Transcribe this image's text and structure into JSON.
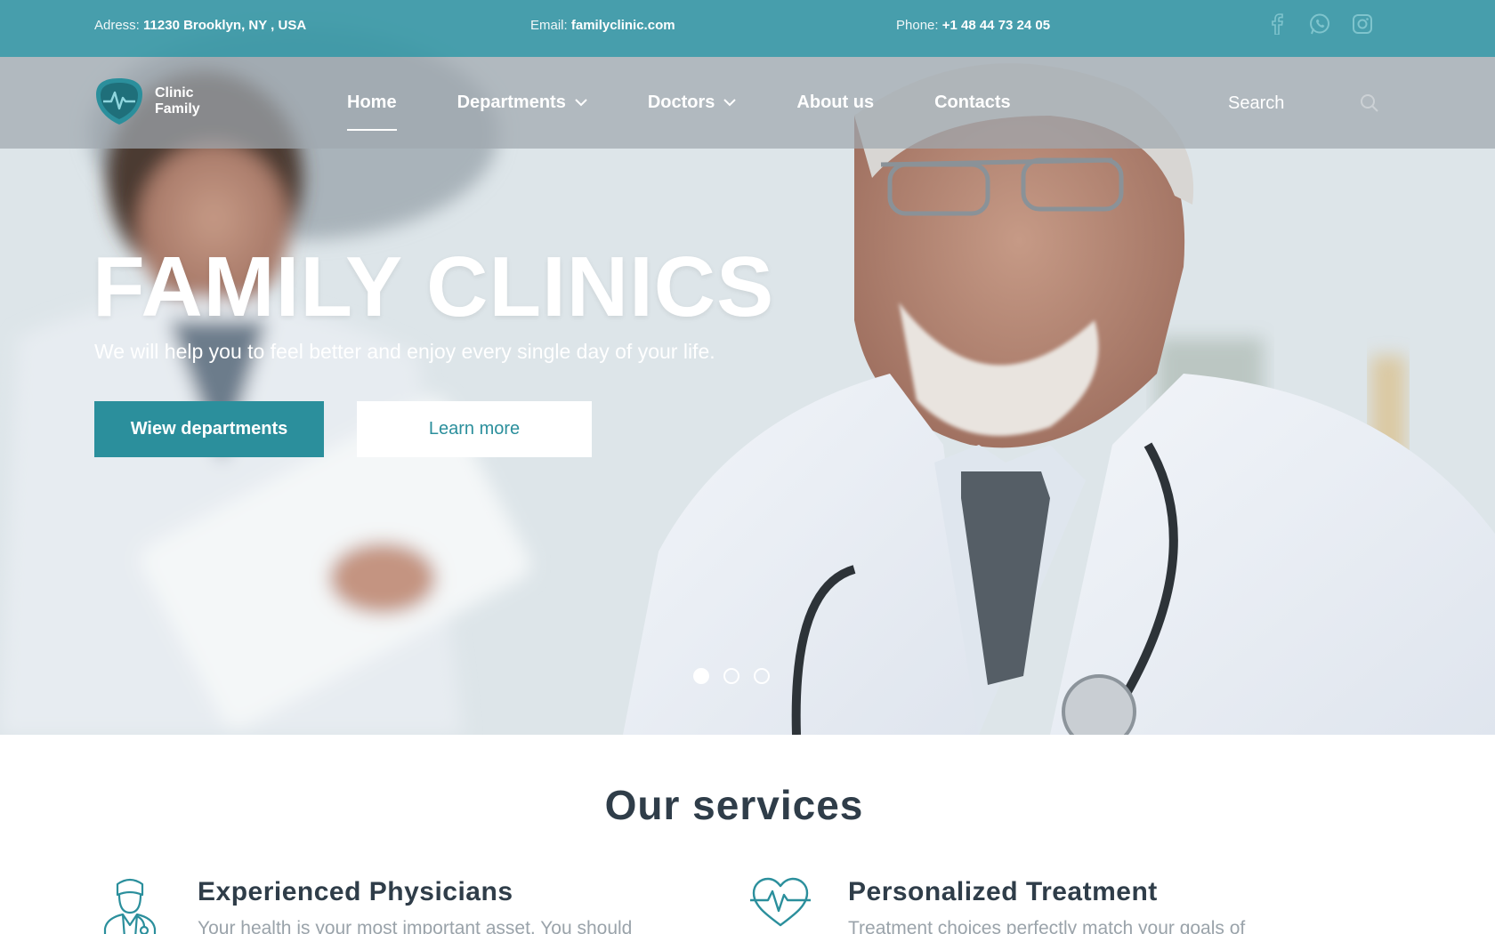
{
  "topbar": {
    "address_label": "Adress:",
    "address_value": "11230 Brooklyn, NY , USA",
    "email_label": "Email:",
    "email_value": "familyclinic.com",
    "phone_label": "Phone:",
    "phone_value": "+1 48 44 73 24 05",
    "socials": [
      "facebook-icon",
      "whatsapp-icon",
      "instagram-icon"
    ]
  },
  "logo": {
    "line1": "Clinic",
    "line2": "Family"
  },
  "nav": {
    "items": [
      {
        "label": "Home",
        "active": true
      },
      {
        "label": "Departments",
        "dropdown": true
      },
      {
        "label": "Doctors",
        "dropdown": true
      },
      {
        "label": "About us"
      },
      {
        "label": "Contacts"
      }
    ],
    "search_placeholder": "Search"
  },
  "hero": {
    "title": "FAMILY CLINICS",
    "subtitle": "We will help you to feel better and enjoy every single day of your life.",
    "primary_button": "Wiew departments",
    "secondary_button": "Learn more",
    "slides": 3,
    "active_slide": 1
  },
  "services": {
    "title": "Our services",
    "items": [
      {
        "icon": "doctor-icon",
        "title": "Experienced Physicians",
        "text": "Your health is your most important asset. You should"
      },
      {
        "icon": "heartbeat-icon",
        "title": "Personalized Treatment",
        "text": "Treatment choices perfectly match your goals of"
      }
    ]
  },
  "colors": {
    "brand": "#2b8f9c",
    "topbar": "#3a98a6",
    "heading": "#2f3d49"
  }
}
